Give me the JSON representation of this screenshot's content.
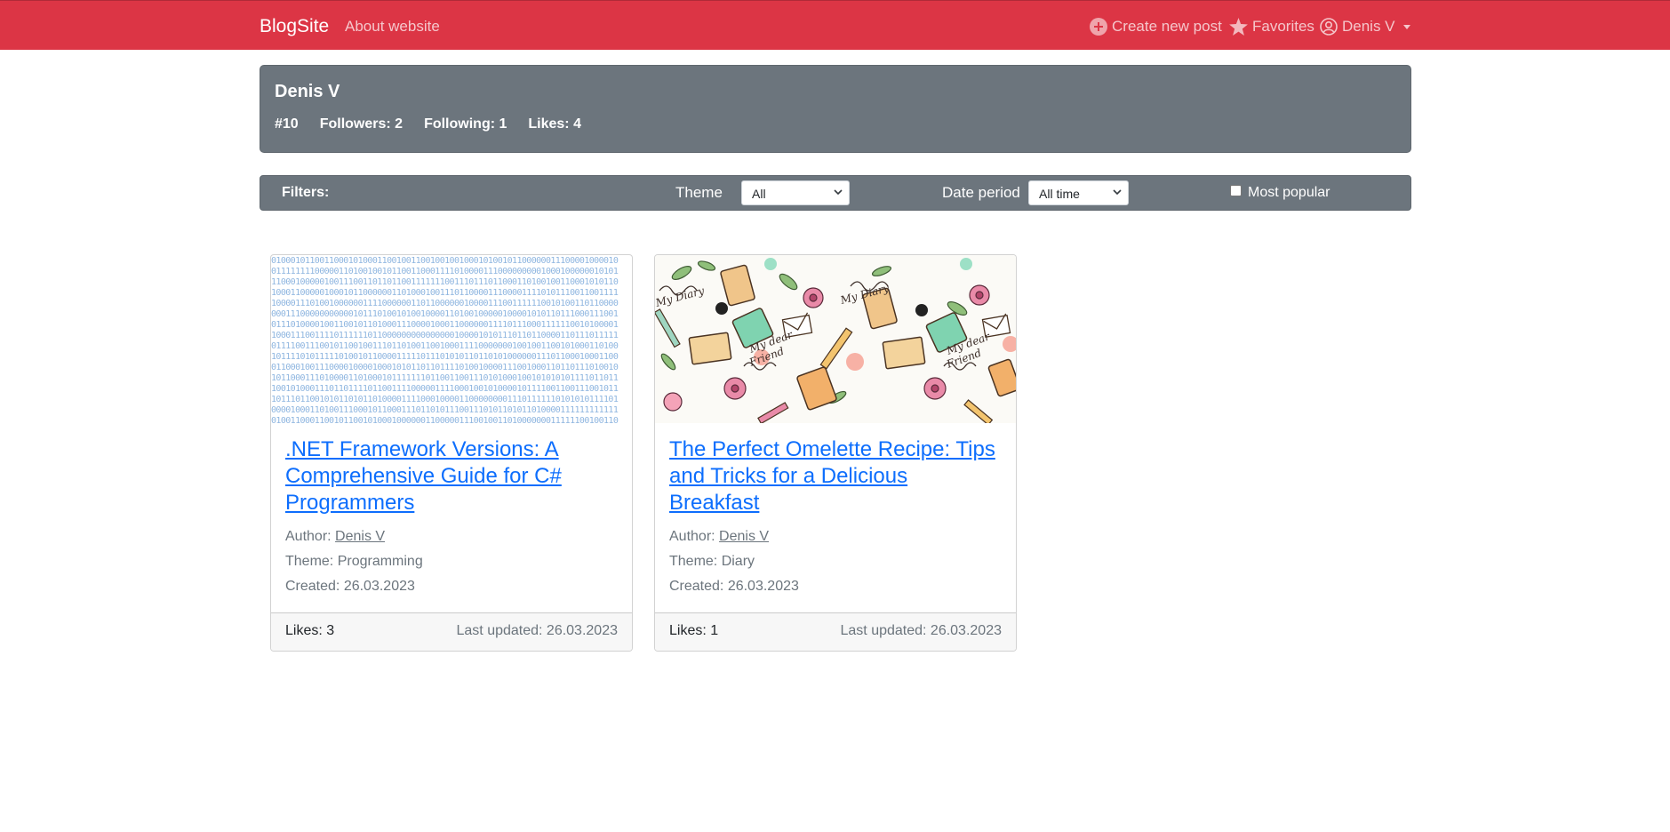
{
  "navbar": {
    "brand": "BlogSite",
    "about": "About website",
    "create_post": "Create new post",
    "favorites": "Favorites",
    "user": "Denis V",
    "bg_color": "#dc3545"
  },
  "profile": {
    "name": "Denis V",
    "id": "#10",
    "followers": "Followers: 2",
    "following": "Following: 1",
    "likes": "Likes: 4"
  },
  "filters": {
    "title": "Filters:",
    "theme_label": "Theme",
    "theme_value": "All",
    "date_label": "Date period",
    "date_value": "All time",
    "popular_label": "Most popular",
    "popular_checked": false
  },
  "posts": [
    {
      "title": ".NET Framework Versions: A Comprehensive Guide for C# Programmers",
      "author_label": "Author:",
      "author": "Denis V",
      "theme": "Theme: Programming",
      "created": "Created: 26.03.2023",
      "likes": "Likes: 3",
      "updated": "Last updated: 26.03.2023",
      "image": "binary-pattern"
    },
    {
      "title": "The Perfect Omelette Recipe: Tips and Tricks for a Delicious Breakfast",
      "author_label": "Author:",
      "author": "Denis V",
      "theme": "Theme: Diary",
      "created": "Created: 26.03.2023",
      "likes": "Likes: 1",
      "updated": "Last updated: 26.03.2023",
      "image": "diary-doodle-pattern"
    }
  ]
}
